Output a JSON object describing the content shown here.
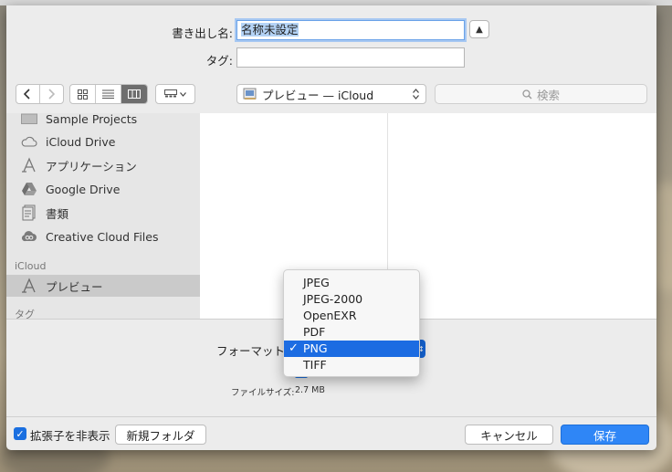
{
  "form": {
    "export_as_label": "書き出し名:",
    "export_as_value": "名称未設定",
    "tags_label": "タグ:",
    "tags_value": ""
  },
  "toolbar": {
    "location": "プレビュー — iCloud",
    "search_placeholder": "検索"
  },
  "sidebar": {
    "items_top": [
      {
        "label": "Sample Projects",
        "icon": "folder-icon"
      },
      {
        "label": "iCloud Drive",
        "icon": "cloud-icon"
      },
      {
        "label": "アプリケーション",
        "icon": "applications-icon"
      },
      {
        "label": "Google Drive",
        "icon": "google-drive-icon"
      },
      {
        "label": "書類",
        "icon": "documents-icon"
      },
      {
        "label": "Creative Cloud Files",
        "icon": "creative-cloud-icon"
      }
    ],
    "icloud_header": "iCloud",
    "icloud_items": [
      {
        "label": "プレビュー",
        "icon": "applications-icon",
        "selected": true
      }
    ],
    "tags_header": "タグ"
  },
  "options": {
    "format_label": "フォーマット",
    "format_options": [
      "JPEG",
      "JPEG-2000",
      "OpenEXR",
      "PDF",
      "PNG",
      "TIFF"
    ],
    "format_selected": "PNG",
    "file_size_label": "ファイルサイズ:",
    "file_size_value": "2.7 MB"
  },
  "footer": {
    "hide_extension_label": "拡張子を非表示",
    "hide_extension_checked": true,
    "new_folder": "新規フォルダ",
    "cancel": "キャンセル",
    "save": "保存"
  },
  "colors": {
    "accent": "#1c6ce2",
    "primary_button": "#2f86f6"
  }
}
